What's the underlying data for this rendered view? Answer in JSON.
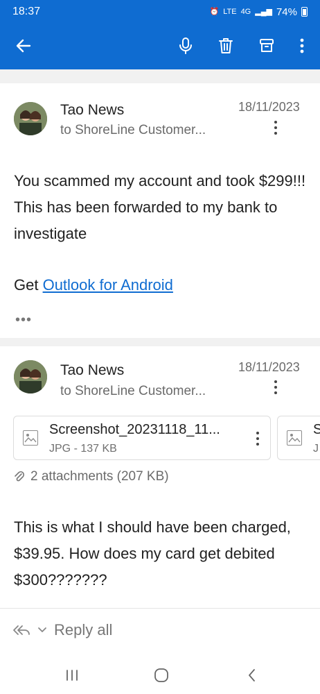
{
  "status": {
    "time": "18:37",
    "network": "4G",
    "lte": "LTE",
    "battery": "74%"
  },
  "toolbar": {
    "back_icon": "arrow-left-icon",
    "mic_icon": "microphone-icon",
    "delete_icon": "trash-icon",
    "archive_icon": "archive-icon",
    "more_icon": "more-vertical-icon"
  },
  "messages": [
    {
      "sender": "Tao News",
      "recipient": "to ShoreLine Customer...",
      "date": "18/11/2023",
      "body": "You scammed my account and took $299!!! This has been forwarded to my bank to investigate",
      "signature_prefix": "Get ",
      "signature_link": "Outlook for Android",
      "ellipsis": "•••"
    },
    {
      "sender": "Tao News",
      "recipient": "to ShoreLine Customer...",
      "date": "18/11/2023",
      "attachments": [
        {
          "name": "Screenshot_20231118_11...",
          "meta": "JPG - 137 KB"
        },
        {
          "name": "S",
          "meta": "J"
        }
      ],
      "attachment_summary": "2 attachments (207 KB)",
      "body": "This is what I should have been charged, $39.95. How does my card get debited $300???????"
    }
  ],
  "reply": {
    "label": "Reply all"
  },
  "colors": {
    "accent": "#0f6cd1",
    "link": "#0f6cd1",
    "muted": "#6b6b6b"
  }
}
